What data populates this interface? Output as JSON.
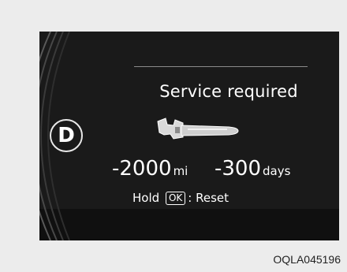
{
  "cluster": {
    "gear": "D",
    "title": "Service required",
    "icon": "wrench-icon",
    "distance": {
      "value": "-2000",
      "unit": "mi"
    },
    "time": {
      "value": "-300",
      "unit": "days"
    },
    "reset": {
      "prefix": "Hold",
      "key": "OK",
      "suffix": ": Reset"
    }
  },
  "caption": "OQLA045196",
  "colors": {
    "background": "#ececec",
    "panel": "#1a1a1a",
    "text": "#ffffff"
  }
}
